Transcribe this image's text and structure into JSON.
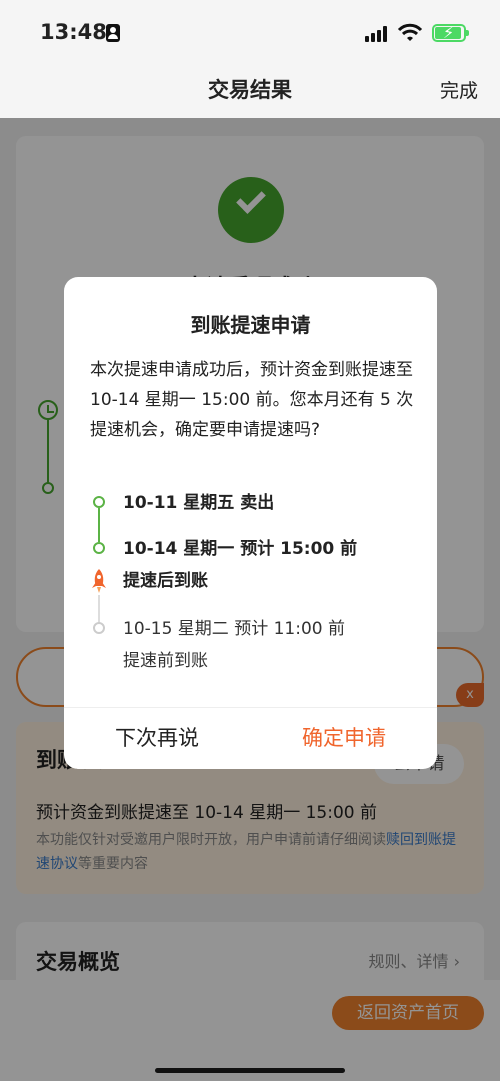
{
  "status_bar": {
    "time": "13:48"
  },
  "nav": {
    "title": "交易结果",
    "done": "完成"
  },
  "background": {
    "result_title": "申请受理成功",
    "promo": {
      "title": "到账提速",
      "button": "去申请",
      "line": "预计资金到账提速至 10-14 星期一 15:00 前",
      "note_prefix": "本功能仅针对受邀用户限时开放，用户申请前请仔细阅读",
      "note_link": "赎回到账提速协议",
      "note_suffix": "等重要内容"
    },
    "overview": {
      "title": "交易概览",
      "link": "规则、详情"
    },
    "close_badge": "x",
    "back_button": "返回资产首页"
  },
  "dialog": {
    "title": "到账提速申请",
    "body": "本次提速申请成功后，预计资金到账提速至 10-14 星期一 15:00 前。您本月还有 5 次提速机会，确定要申请提速吗?",
    "steps": [
      {
        "line1": "10-11 星期五 卖出",
        "line2": ""
      },
      {
        "line1": "10-14 星期一 预计 15:00 前",
        "line2": "提速后到账"
      },
      {
        "line1": "10-15 星期二 预计 11:00 前",
        "line2": "提速前到账"
      }
    ],
    "cancel": "下次再说",
    "confirm": "确定申请"
  },
  "colors": {
    "accent": "#f0652d",
    "success": "#46a52d",
    "link": "#3a7ac9"
  }
}
